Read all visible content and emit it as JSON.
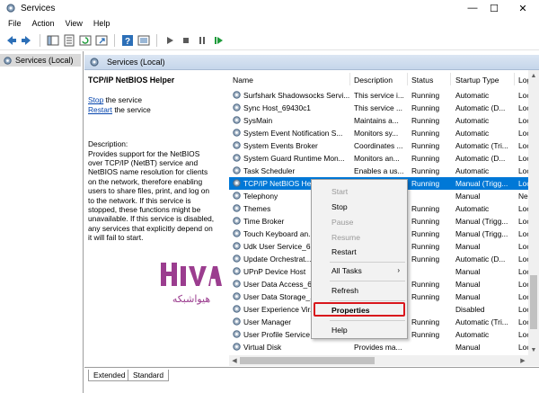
{
  "window": {
    "title": "Services",
    "controls": {
      "minimize": "—",
      "maximize": "☐",
      "close": "✕"
    }
  },
  "menu": [
    "File",
    "Action",
    "View",
    "Help"
  ],
  "toolbar": [
    "back-icon",
    "forward-icon",
    "console-tree-icon",
    "properties-icon",
    "refresh-icon",
    "export-icon",
    "help-icon",
    "view-icon",
    "start-icon",
    "stop-icon",
    "pause-icon",
    "restart-icon"
  ],
  "tree": {
    "label": "Services (Local)"
  },
  "panel": {
    "title": "Services (Local)"
  },
  "desc": {
    "service": "TCP/IP NetBIOS Helper",
    "stop_link": "Stop",
    "stop_rest": " the service",
    "restart_link": "Restart",
    "restart_rest": " the service",
    "label": "Description:",
    "lines": [
      "Provides support for the NetBIOS",
      "over TCP/IP (NetBT) service and",
      "NetBIOS name resolution for clients",
      "on the network, therefore enabling",
      "users to share files, print, and log on",
      "to the network. If this service is",
      "stopped, these functions might be",
      "unavailable. If this service is disabled,",
      "any services that explicitly depend on",
      "it will fail to start."
    ]
  },
  "logo": {
    "text": "HIVA",
    "subtitle": "هیواشبکه",
    "color": "#9b3d8f"
  },
  "columns": [
    "Name",
    "Description",
    "Status",
    "Startup Type",
    "Log"
  ],
  "rows": [
    [
      "Surfshark Shadowsocks Servi...",
      "This service i...",
      "Running",
      "Automatic",
      "Loc"
    ],
    [
      "Sync Host_69430c1",
      "This service ...",
      "Running",
      "Automatic (D...",
      "Loc"
    ],
    [
      "SysMain",
      "Maintains a...",
      "Running",
      "Automatic",
      "Loc"
    ],
    [
      "System Event Notification S...",
      "Monitors sy...",
      "Running",
      "Automatic",
      "Loc"
    ],
    [
      "System Events Broker",
      "Coordinates ...",
      "Running",
      "Automatic (Tri...",
      "Loc"
    ],
    [
      "System Guard Runtime Mon...",
      "Monitors an...",
      "Running",
      "Automatic (D...",
      "Loc"
    ],
    [
      "Task Scheduler",
      "Enables a us...",
      "Running",
      "Automatic",
      "Loc"
    ],
    [
      "TCP/IP NetBIOS Helper",
      "",
      "Running",
      "Manual (Trigg...",
      "Loc"
    ],
    [
      "Telephony",
      "",
      "",
      "Manual",
      "Ne"
    ],
    [
      "Themes",
      "",
      "Running",
      "Automatic",
      "Loc"
    ],
    [
      "Time Broker",
      "",
      "Running",
      "Manual (Trigg...",
      "Loc"
    ],
    [
      "Touch Keyboard an...",
      "",
      "Running",
      "Manual (Trigg...",
      "Loc"
    ],
    [
      "Udk User Service_6...",
      "",
      "Running",
      "Manual",
      "Loc"
    ],
    [
      "Update Orchestrat...",
      "",
      "Running",
      "Automatic (D...",
      "Loc"
    ],
    [
      "UPnP Device Host",
      "",
      "",
      "Manual",
      "Loc"
    ],
    [
      "User Data Access_6...",
      "",
      "Running",
      "Manual",
      "Loc"
    ],
    [
      "User Data Storage_...",
      "",
      "Running",
      "Manual",
      "Loc"
    ],
    [
      "User Experience Vir...",
      "",
      "",
      "Disabled",
      "Loc"
    ],
    [
      "User Manager",
      "",
      "Running",
      "Automatic (Tri...",
      "Loc"
    ],
    [
      "User Profile Service",
      "",
      "Running",
      "Automatic",
      "Loc"
    ],
    [
      "Virtual Disk",
      "Provides ma...",
      "",
      "Manual",
      "Loc"
    ]
  ],
  "context_menu": {
    "start": "Start",
    "stop": "Stop",
    "pause": "Pause",
    "resume": "Resume",
    "restart": "Restart",
    "all_tasks": "All Tasks",
    "all_tasks_arrow": "›",
    "refresh": "Refresh",
    "properties": "Properties",
    "help": "Help"
  },
  "tabs": [
    "Extended",
    "Standard"
  ],
  "colors": {
    "selection": "#0078d7",
    "highlight_box": "#d9161c"
  }
}
